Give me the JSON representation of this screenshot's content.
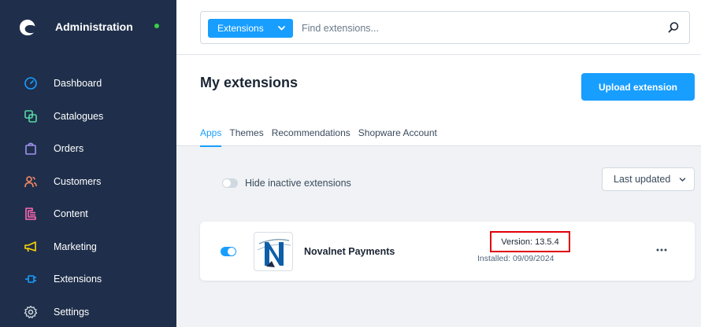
{
  "app": {
    "title": "Administration",
    "online_color": "#37d046"
  },
  "sidebar": {
    "items": [
      {
        "label": "Dashboard",
        "icon": "gauge-icon",
        "color": "#189eff"
      },
      {
        "label": "Catalogues",
        "icon": "catalogue-icon",
        "color": "#57d9a3"
      },
      {
        "label": "Orders",
        "icon": "shopping-bag-icon",
        "color": "#a092f0"
      },
      {
        "label": "Customers",
        "icon": "users-icon",
        "color": "#f88962"
      },
      {
        "label": "Content",
        "icon": "content-icon",
        "color": "#ff68b4"
      },
      {
        "label": "Marketing",
        "icon": "megaphone-icon",
        "color": "#ffd700"
      },
      {
        "label": "Extensions",
        "icon": "plug-icon",
        "color": "#189eff"
      },
      {
        "label": "Settings",
        "icon": "gear-icon",
        "color": "#d1d9e0"
      }
    ]
  },
  "search": {
    "type_label": "Extensions",
    "placeholder": "Find extensions..."
  },
  "header": {
    "title": "My extensions",
    "upload_label": "Upload extension"
  },
  "tabs": [
    {
      "label": "Apps",
      "active": true
    },
    {
      "label": "Themes",
      "active": false
    },
    {
      "label": "Recommendations",
      "active": false
    },
    {
      "label": "Shopware Account",
      "active": false
    }
  ],
  "filters": {
    "hide_inactive_label": "Hide inactive extensions",
    "sort_label": "Last updated"
  },
  "extensions": [
    {
      "name": "Novalnet Payments",
      "version": "Version: 13.5.4",
      "installed": "Installed: 09/09/2024",
      "active": true
    }
  ],
  "colors": {
    "accent": "#189eff",
    "sidebar_bg": "#1f2f4b",
    "highlight_border": "#e0000a"
  }
}
